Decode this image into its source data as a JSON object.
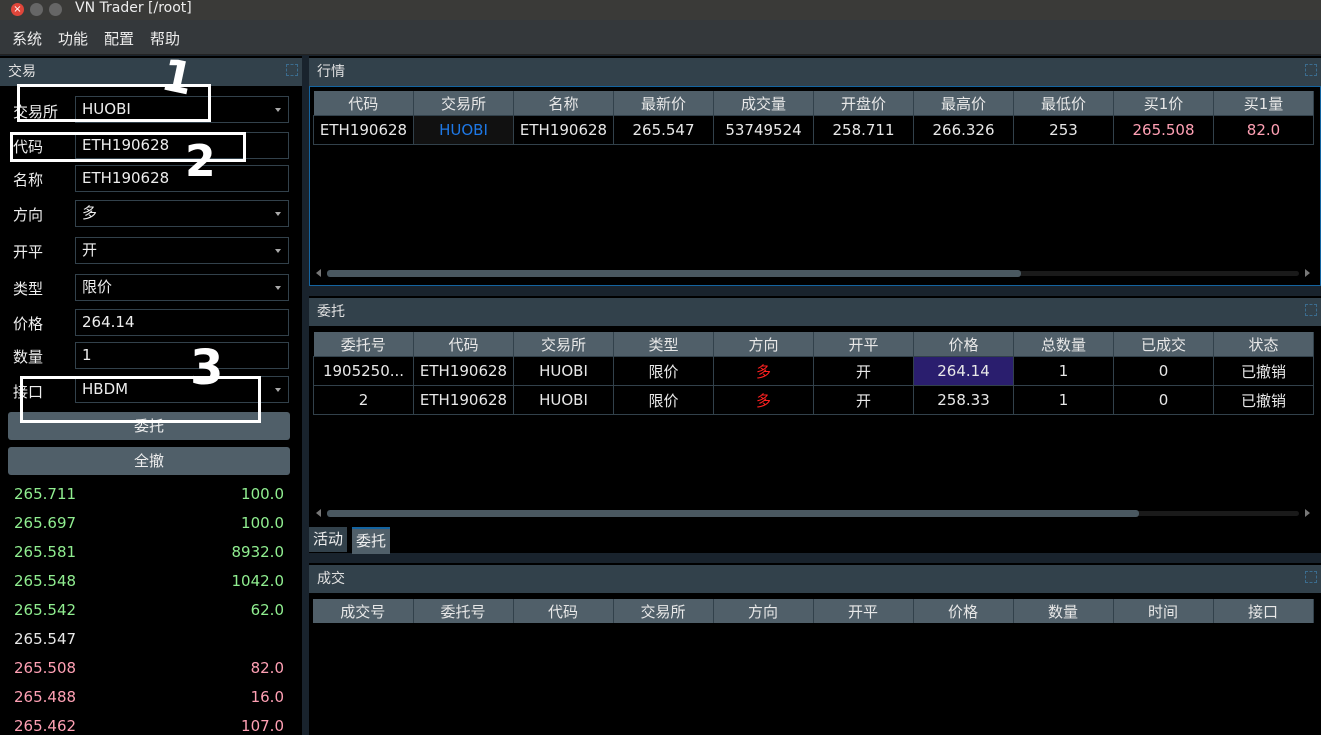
{
  "window": {
    "title": "VN Trader [/root]"
  },
  "menu": [
    "系统",
    "功能",
    "配置",
    "帮助"
  ],
  "trade_panel": {
    "title": "交易",
    "fields": {
      "exchange": {
        "label": "交易所",
        "value": "HUOBI"
      },
      "symbol": {
        "label": "代码",
        "value": "ETH190628"
      },
      "name": {
        "label": "名称",
        "value": "ETH190628"
      },
      "direction": {
        "label": "方向",
        "value": "多"
      },
      "offset": {
        "label": "开平",
        "value": "开"
      },
      "type": {
        "label": "类型",
        "value": "限价"
      },
      "price": {
        "label": "价格",
        "value": "264.14"
      },
      "volume": {
        "label": "数量",
        "value": "1"
      },
      "gateway": {
        "label": "接口",
        "value": "HBDM"
      }
    },
    "send_button": "委托",
    "cancel_all_button": "全撤",
    "depth": [
      {
        "price": "265.711",
        "volume": "100.0",
        "side": "ask"
      },
      {
        "price": "265.697",
        "volume": "100.0",
        "side": "ask"
      },
      {
        "price": "265.581",
        "volume": "8932.0",
        "side": "ask"
      },
      {
        "price": "265.548",
        "volume": "1042.0",
        "side": "ask"
      },
      {
        "price": "265.542",
        "volume": "62.0",
        "side": "ask"
      },
      {
        "price": "265.547",
        "volume": "",
        "side": "last"
      },
      {
        "price": "265.508",
        "volume": "82.0",
        "side": "bid"
      },
      {
        "price": "265.488",
        "volume": "16.0",
        "side": "bid"
      },
      {
        "price": "265.462",
        "volume": "107.0",
        "side": "bid"
      }
    ]
  },
  "annotations": {
    "marks": [
      "1",
      "2",
      "3"
    ]
  },
  "market_panel": {
    "title": "行情",
    "headers": [
      "代码",
      "交易所",
      "名称",
      "最新价",
      "成交量",
      "开盘价",
      "最高价",
      "最低价",
      "买1价",
      "买1量"
    ],
    "rows": [
      [
        "ETH190628",
        "HUOBI",
        "ETH190628",
        "265.547",
        "53749524",
        "258.711",
        "266.326",
        "253",
        "265.508",
        "82.0"
      ]
    ]
  },
  "order_panel": {
    "title": "委托",
    "headers": [
      "委托号",
      "代码",
      "交易所",
      "类型",
      "方向",
      "开平",
      "价格",
      "总数量",
      "已成交",
      "状态"
    ],
    "rows": [
      [
        "1905250...",
        "ETH190628",
        "HUOBI",
        "限价",
        "多",
        "开",
        "264.14",
        "1",
        "0",
        "已撤销"
      ],
      [
        "2",
        "ETH190628",
        "HUOBI",
        "限价",
        "多",
        "开",
        "258.33",
        "1",
        "0",
        "已撤销"
      ]
    ],
    "tabs": [
      "活动",
      "委托"
    ]
  },
  "trade_records_panel": {
    "title": "成交",
    "headers": [
      "成交号",
      "委托号",
      "代码",
      "交易所",
      "方向",
      "开平",
      "价格",
      "数量",
      "时间",
      "接口"
    ]
  },
  "colors": {
    "ask": "#90ee90",
    "bid": "#ffa0b4",
    "long": "#ff2020",
    "exchange_link": "#1e78e6",
    "selected_cell": "#2a1e6e"
  }
}
